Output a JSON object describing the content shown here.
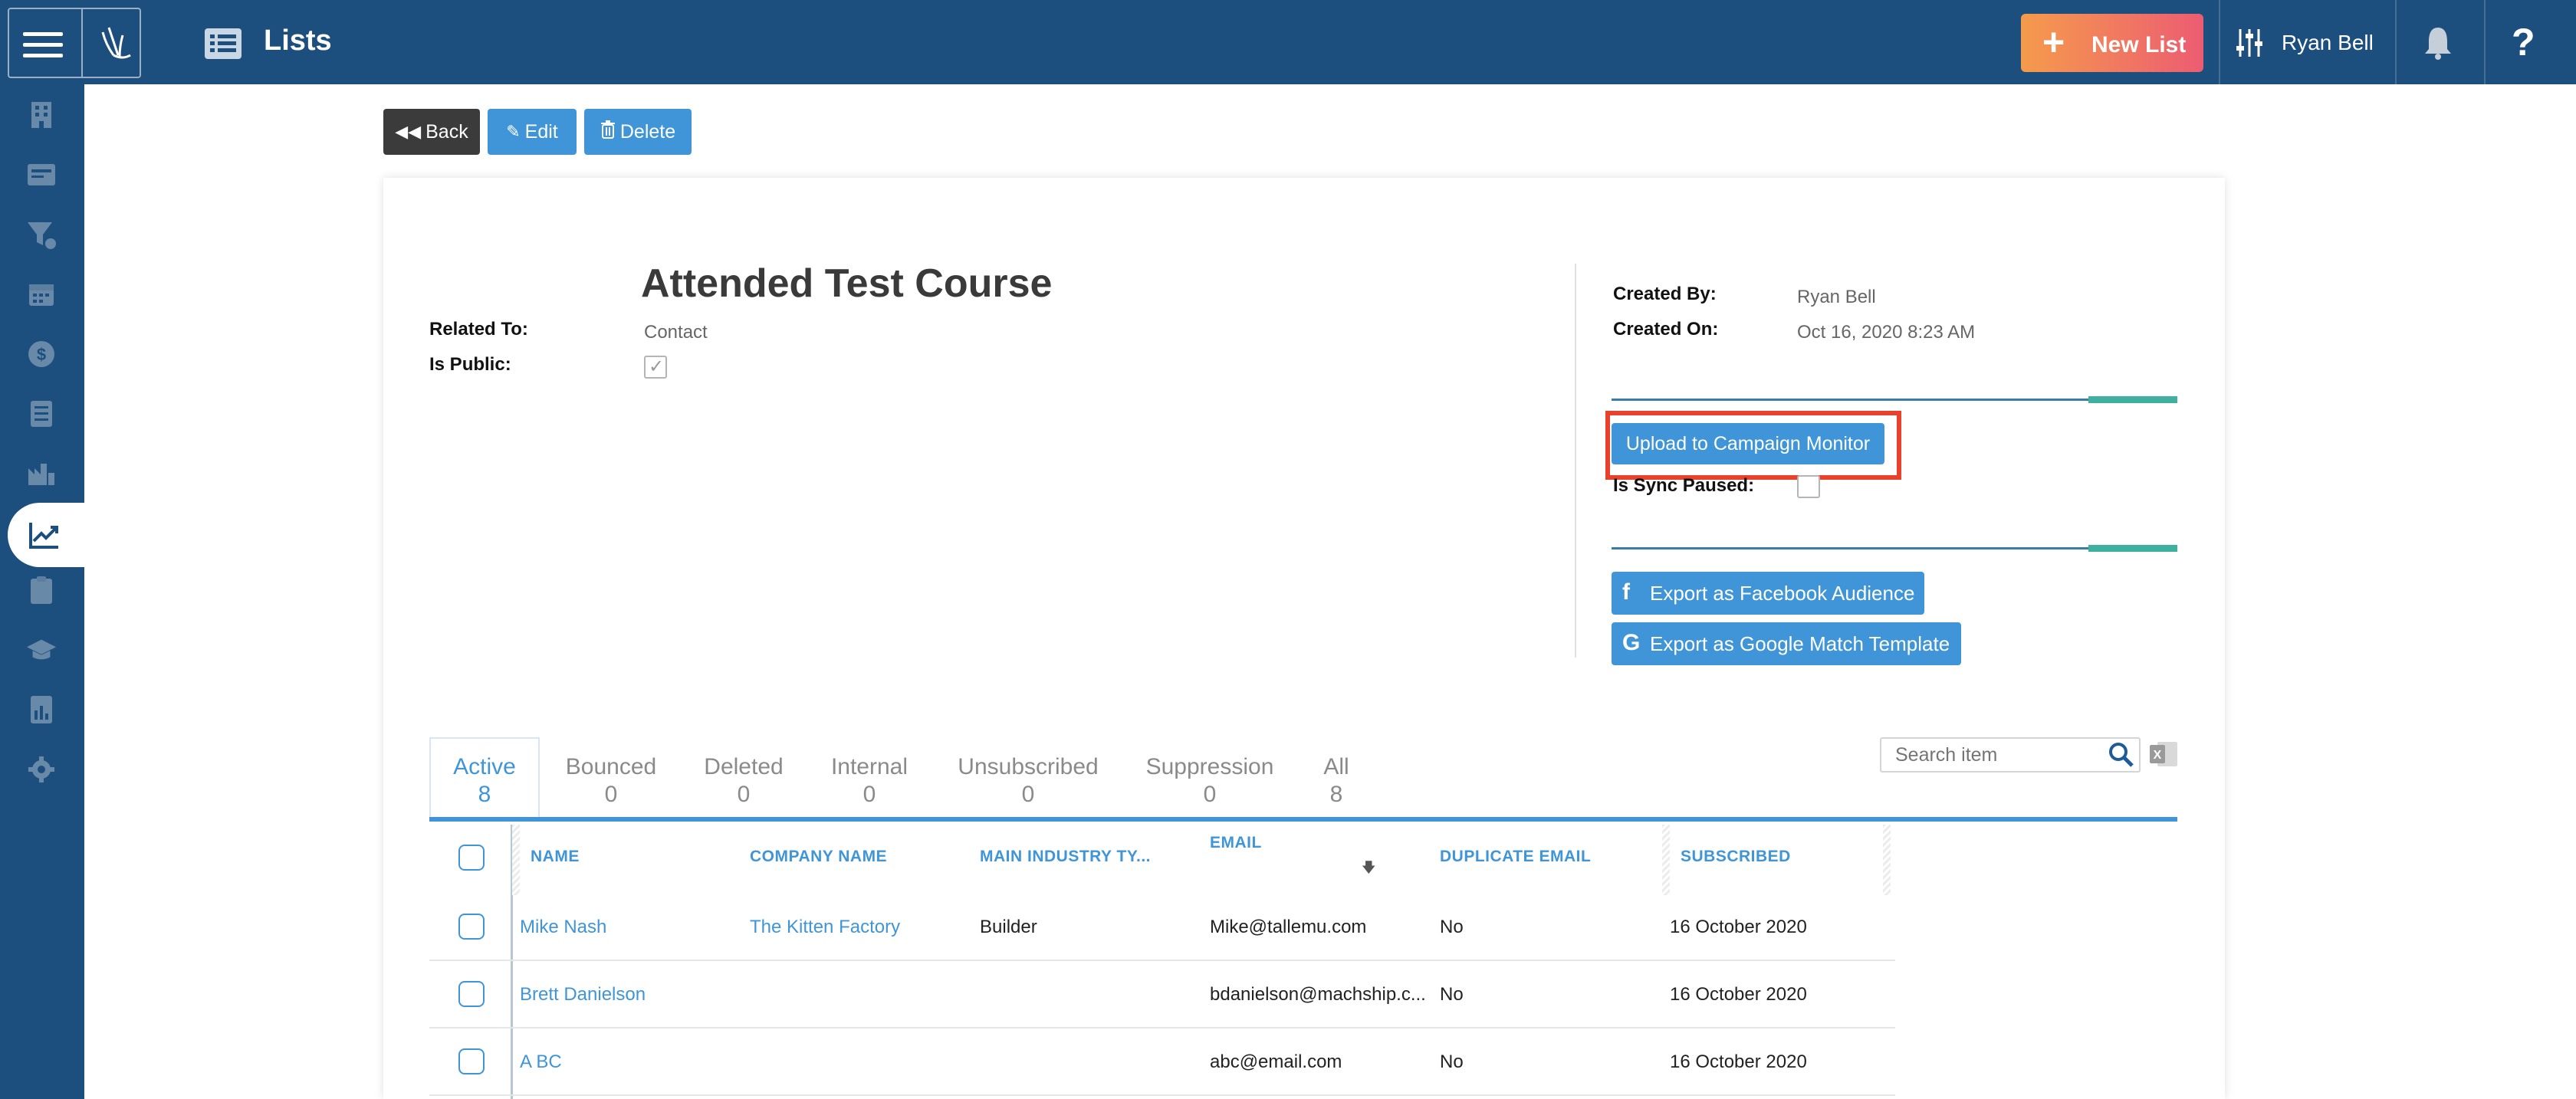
{
  "app": {
    "title": "Lists"
  },
  "header": {
    "new_list_label": "New List",
    "user_name": "Ryan Bell",
    "help_glyph": "?"
  },
  "sidebar": {
    "icons": [
      "building-icon",
      "contact-card-icon",
      "sales-funnel-icon",
      "calendar-icon",
      "dollar-icon",
      "list-icon",
      "factory-chart-icon",
      "trending-chart-icon",
      "clipboard-icon",
      "graduation-cap-icon",
      "report-icon",
      "gear-icon"
    ],
    "active_index": 7
  },
  "toolbar": {
    "back_label": "Back",
    "edit_label": "Edit",
    "delete_label": "Delete"
  },
  "record": {
    "title": "Attended Test Course",
    "related_to_label": "Related To:",
    "related_to_value": "Contact",
    "is_public_label": "Is Public:",
    "is_public_checked": true,
    "created_by_label": "Created By:",
    "created_by_value": "Ryan Bell",
    "created_on_label": "Created On:",
    "created_on_value": "Oct 16, 2020 8:23 AM",
    "upload_label": "Upload to Campaign Monitor",
    "sync_paused_label": "Is Sync Paused:",
    "sync_paused_checked": false,
    "export_facebook_label": "Export as Facebook Audience",
    "export_google_label": "Export as Google Match Template"
  },
  "tabs": [
    {
      "label": "Active",
      "count": "8"
    },
    {
      "label": "Bounced",
      "count": "0"
    },
    {
      "label": "Deleted",
      "count": "0"
    },
    {
      "label": "Internal",
      "count": "0"
    },
    {
      "label": "Unsubscribed",
      "count": "0"
    },
    {
      "label": "Suppression",
      "count": "0"
    },
    {
      "label": "All",
      "count": "8"
    }
  ],
  "search": {
    "placeholder": "Search item"
  },
  "table": {
    "columns": [
      "NAME",
      "COMPANY NAME",
      "MAIN INDUSTRY TY...",
      "EMAIL",
      "DUPLICATE EMAIL",
      "SUBSCRIBED"
    ],
    "rows": [
      {
        "name": "Mike Nash",
        "company": "The Kitten Factory",
        "industry": "Builder",
        "email": "Mike@tallemu.com",
        "duplicate": "No",
        "subscribed": "16 October 2020"
      },
      {
        "name": "Brett Danielson",
        "company": "",
        "industry": "",
        "email": "bdanielson@machship.c...",
        "duplicate": "No",
        "subscribed": "16 October 2020"
      },
      {
        "name": "A BC",
        "company": "",
        "industry": "",
        "email": "abc@email.com",
        "duplicate": "No",
        "subscribed": "16 October 2020"
      }
    ]
  },
  "colors": {
    "navy": "#1d4f7e",
    "accent_blue": "#3f95d8",
    "highlight_red": "#e8412c",
    "teal": "#3fb0a0"
  }
}
